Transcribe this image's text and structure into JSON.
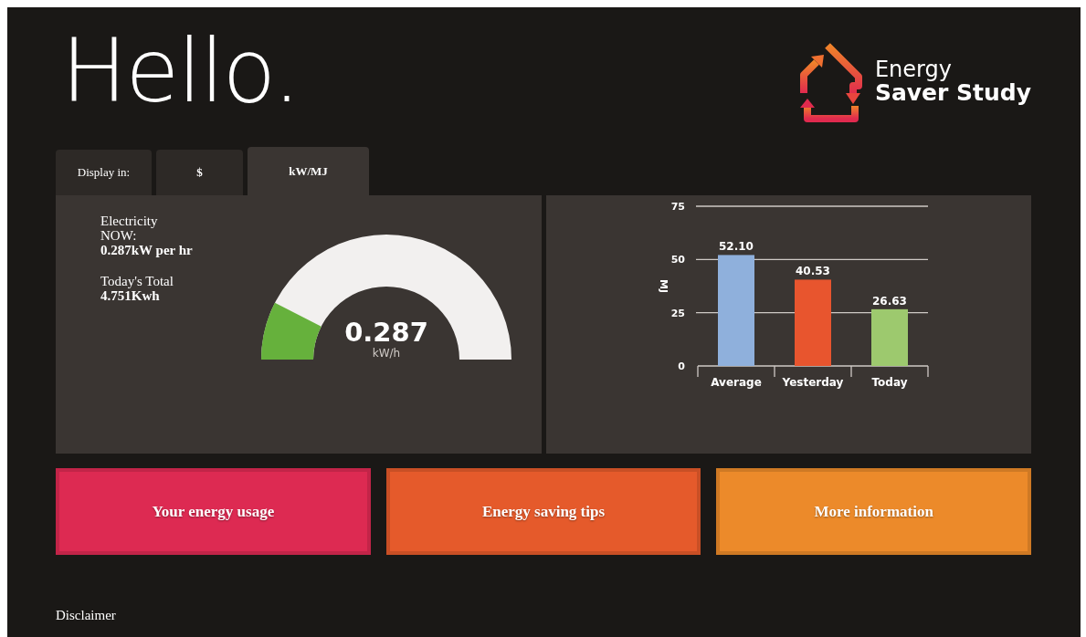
{
  "greeting": "Hello.",
  "logo": {
    "line_1": "Energy",
    "line_2": "Saver Study"
  },
  "tabs": [
    {
      "label": "Display in:",
      "kind": "label",
      "selected": false
    },
    {
      "label": "$",
      "kind": "tab",
      "selected": false
    },
    {
      "label": "kW/MJ",
      "kind": "tab",
      "selected": true
    }
  ],
  "usage": {
    "now_label": "Electricity NOW:",
    "now_value": "0.287kW per hr",
    "total_label": "Today's Total",
    "total_value": "4.751Kwh"
  },
  "gauge": {
    "level": 0.15,
    "reading": "0.287",
    "unit": "kW/h"
  },
  "chart_data": {
    "type": "bar",
    "ylabel": "MJ",
    "categories": [
      "Average",
      "Yesterday",
      "Today"
    ],
    "ylim": [
      0,
      75
    ],
    "yticks": [
      0,
      25,
      50,
      75
    ],
    "values": [
      52.1,
      40.53,
      26.63
    ],
    "colors": [
      "#8fb0dc",
      "#e8552e",
      "#9dc96e"
    ],
    "value_labels": [
      "52.10",
      "40.53",
      "26.63"
    ]
  },
  "tiles": [
    {
      "label": "Your energy usage",
      "color": "#dd2a52"
    },
    {
      "label": "Energy saving tips",
      "color": "#e55a2b"
    },
    {
      "label": "More information",
      "color": "#ec8a2a"
    }
  ],
  "footer": {
    "link": "Disclaimer"
  }
}
